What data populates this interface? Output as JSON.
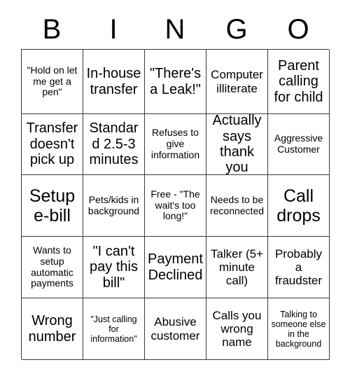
{
  "header": {
    "letters": [
      "B",
      "I",
      "N",
      "G",
      "O"
    ]
  },
  "grid": {
    "columns": 5,
    "rows": 5,
    "border_color": "#3a3a3a",
    "background": "#ffffff",
    "text_color": "#000000",
    "cells": [
      {
        "text": "\"Hold on let me get a pen\"",
        "size": "sm"
      },
      {
        "text": "In-house transfer",
        "size": "lg"
      },
      {
        "text": "\"There's a Leak!\"",
        "size": "lg"
      },
      {
        "text": "Computer illiterate",
        "size": "md"
      },
      {
        "text": "Parent calling for child",
        "size": "lg"
      },
      {
        "text": "Transfer doesn't pick up",
        "size": "lg"
      },
      {
        "text": "Standard 2.5-3 minutes",
        "size": "lg"
      },
      {
        "text": "Refuses to give information",
        "size": "sm"
      },
      {
        "text": "Actually says thank you",
        "size": "lg"
      },
      {
        "text": "Aggressive Customer",
        "size": "sm"
      },
      {
        "text": "Setup e-bill",
        "size": "xl"
      },
      {
        "text": "Pets/kids in background",
        "size": "sm"
      },
      {
        "text": "Free - \"The wait's too long!\"",
        "size": "sm"
      },
      {
        "text": "Needs to be reconnected",
        "size": "sm"
      },
      {
        "text": "Call drops",
        "size": "xl"
      },
      {
        "text": "Wants to setup automatic payments",
        "size": "sm"
      },
      {
        "text": "\"I can't pay this bill\"",
        "size": "lg"
      },
      {
        "text": "Payment Declined",
        "size": "lg"
      },
      {
        "text": "Talker (5+ minute call)",
        "size": "md"
      },
      {
        "text": "Probably a fraudster",
        "size": "md"
      },
      {
        "text": "Wrong number",
        "size": "lg"
      },
      {
        "text": "\"Just calling for information\"",
        "size": "xs"
      },
      {
        "text": "Abusive customer",
        "size": "md"
      },
      {
        "text": "Calls you wrong name",
        "size": "md"
      },
      {
        "text": "Talking to someone else in the background",
        "size": "xs"
      }
    ]
  }
}
